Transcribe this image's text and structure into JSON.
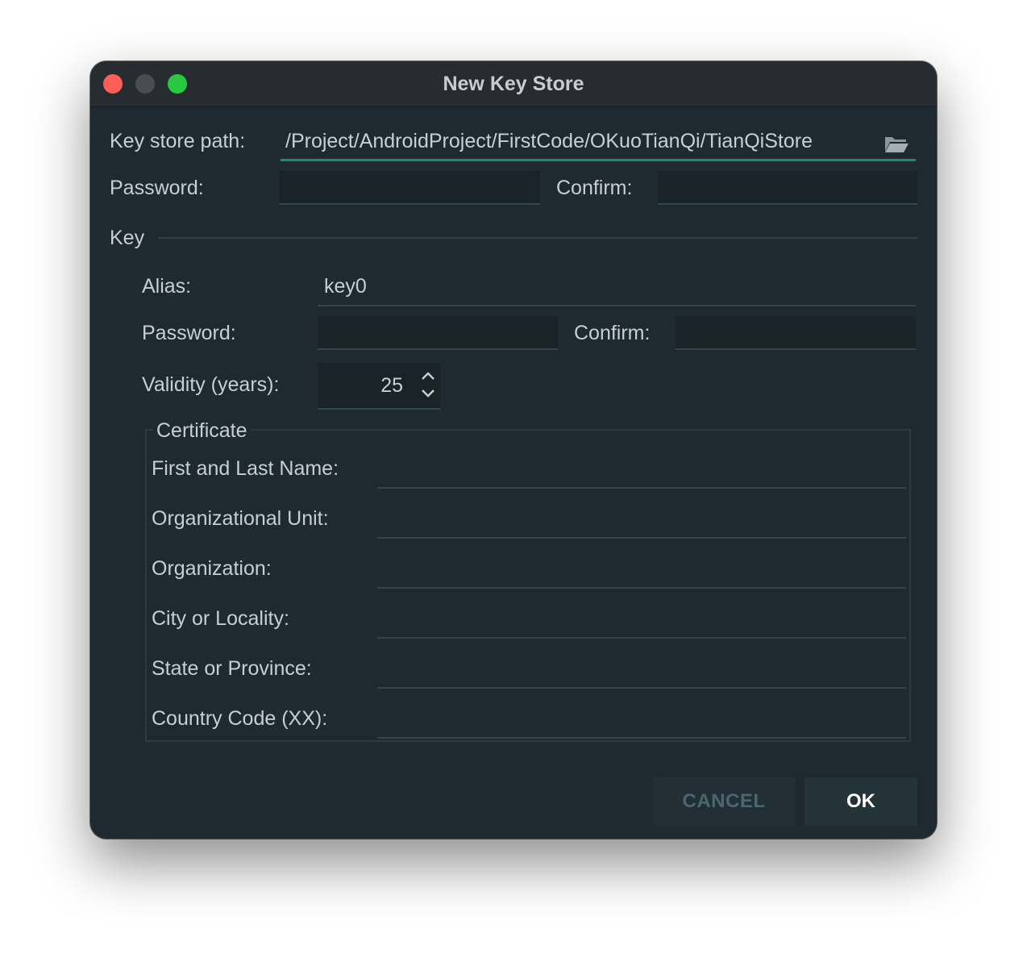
{
  "window": {
    "title": "New Key Store"
  },
  "keystore": {
    "path_label": "Key store path:",
    "path_value": "/Project/AndroidProject/FirstCode/OKuoTianQi/TianQiStore",
    "password_label": "Password:",
    "password_value": "",
    "confirm_label": "Confirm:",
    "confirm_value": ""
  },
  "key": {
    "section_label": "Key",
    "alias_label": "Alias:",
    "alias_value": "key0",
    "password_label": "Password:",
    "password_value": "",
    "confirm_label": "Confirm:",
    "confirm_value": "",
    "validity_label": "Validity (years):",
    "validity_value": "25"
  },
  "certificate": {
    "legend": "Certificate",
    "fields": [
      {
        "label": "First and Last Name:",
        "value": ""
      },
      {
        "label": "Organizational Unit:",
        "value": ""
      },
      {
        "label": "Organization:",
        "value": ""
      },
      {
        "label": "City or Locality:",
        "value": ""
      },
      {
        "label": "State or Province:",
        "value": ""
      },
      {
        "label": "Country Code (XX):",
        "value": ""
      }
    ]
  },
  "buttons": {
    "cancel": "CANCEL",
    "ok": "OK"
  },
  "icons": {
    "browse": "folder-open-icon",
    "spinner_up": "chevron-up-icon",
    "spinner_down": "chevron-down-icon"
  },
  "colors": {
    "window_bg": "#1e2a30",
    "titlebar_bg": "#272c30",
    "accent_focus": "#1e8a78",
    "close": "#fe5f57",
    "minimize": "#4a4d50",
    "maximize": "#28c840"
  }
}
